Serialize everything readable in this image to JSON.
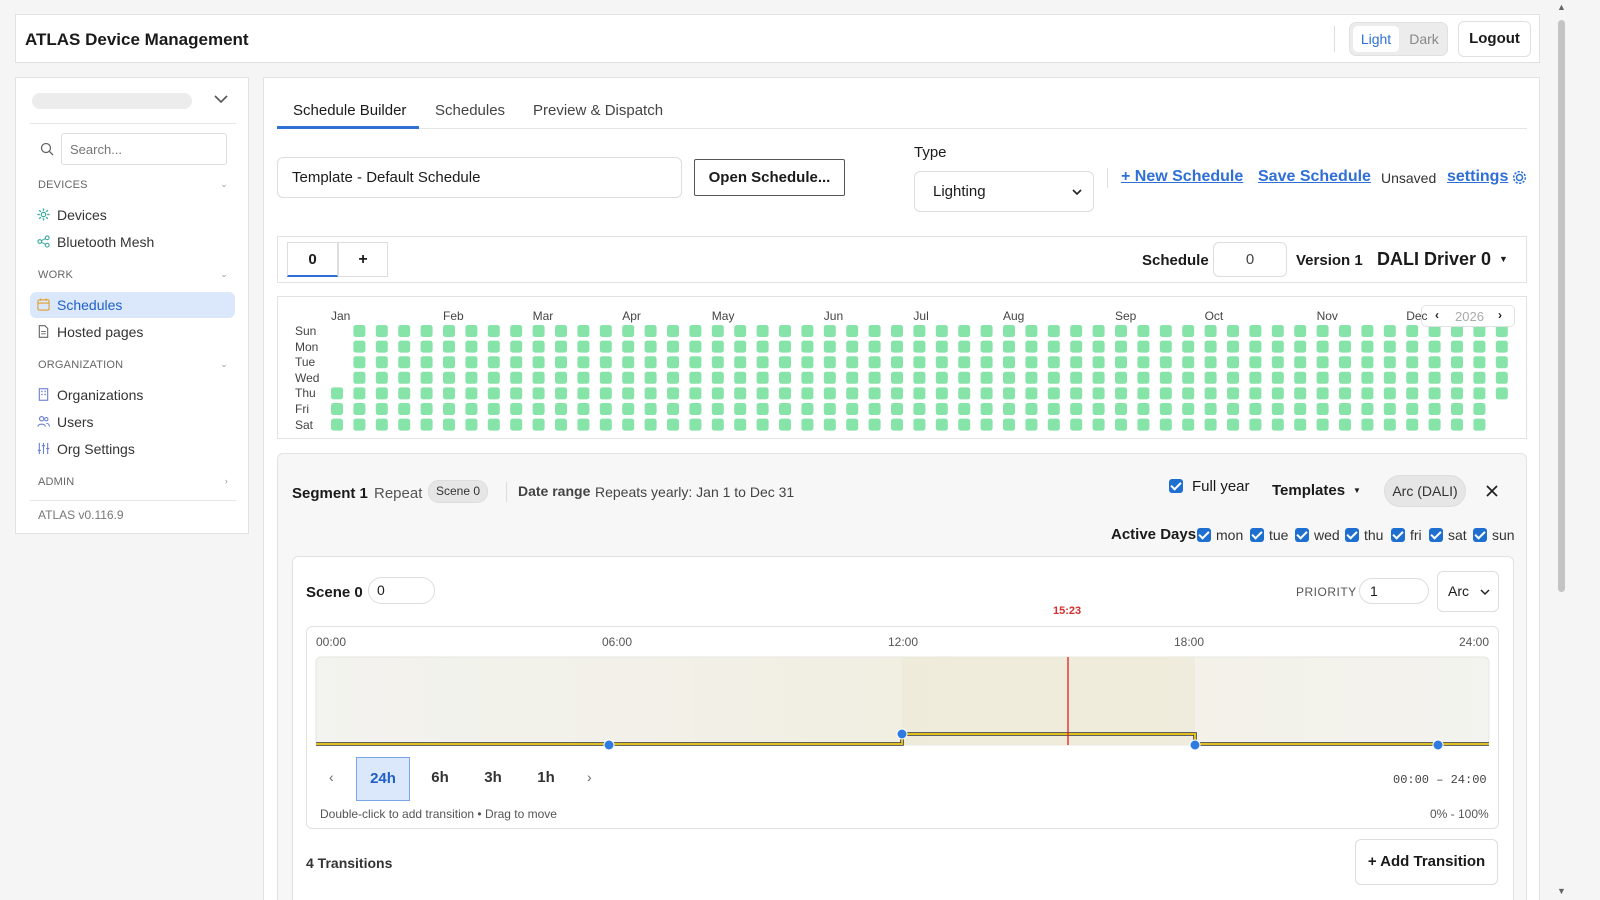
{
  "header": {
    "title": "ATLAS Device Management",
    "theme_light": "Light",
    "theme_dark": "Dark",
    "logout": "Logout"
  },
  "sidebar": {
    "search_placeholder": "Search...",
    "sections": [
      {
        "label": "DEVICES",
        "items": [
          {
            "label": "Devices",
            "icon": "gear-icon"
          },
          {
            "label": "Bluetooth Mesh",
            "icon": "share-icon"
          }
        ]
      },
      {
        "label": "WORK",
        "items": [
          {
            "label": "Schedules",
            "icon": "calendar-icon",
            "active": true
          },
          {
            "label": "Hosted pages",
            "icon": "file-icon"
          }
        ]
      },
      {
        "label": "ORGANIZATION",
        "items": [
          {
            "label": "Organizations",
            "icon": "building-icon"
          },
          {
            "label": "Users",
            "icon": "users-icon"
          },
          {
            "label": "Org Settings",
            "icon": "sliders-icon"
          }
        ]
      },
      {
        "label": "ADMIN",
        "items": []
      }
    ],
    "version": "ATLAS v0.116.9"
  },
  "tabs": [
    {
      "label": "Schedule Builder",
      "active": true
    },
    {
      "label": "Schedules"
    },
    {
      "label": "Preview & Dispatch"
    }
  ],
  "toolbar": {
    "template_name": "Template - Default Schedule",
    "open_schedule": "Open Schedule...",
    "type_label": "Type",
    "type_value": "Lighting",
    "new_schedule": "+ New Schedule",
    "save_schedule": "Save Schedule",
    "unsaved": "Unsaved",
    "settings": "settings"
  },
  "schedule_bar": {
    "segment_tab": "0",
    "add_tab": "+",
    "schedule_label": "Schedule",
    "schedule_value": "0",
    "version": "Version 1",
    "driver": "DALI Driver 0"
  },
  "calendar": {
    "year": "2026",
    "months": [
      "Jan",
      "Feb",
      "Mar",
      "Apr",
      "May",
      "Jun",
      "Jul",
      "Aug",
      "Sep",
      "Oct",
      "Nov",
      "Dec"
    ],
    "days": [
      "Sun",
      "Mon",
      "Tue",
      "Wed",
      "Thu",
      "Fri",
      "Sat"
    ],
    "active_color": "#86e4a8"
  },
  "segment": {
    "title": "Segment 1",
    "repeat": "Repeat",
    "scene_badge": "Scene 0",
    "date_range_label": "Date range",
    "date_range_value": "Repeats yearly: Jan 1 to Dec 31",
    "full_year_label": "Full year",
    "full_year_checked": true,
    "templates_label": "Templates",
    "arc_pill": "Arc (DALI)",
    "active_days_label": "Active Days",
    "active_days": [
      {
        "label": "mon",
        "checked": true
      },
      {
        "label": "tue",
        "checked": true
      },
      {
        "label": "wed",
        "checked": true
      },
      {
        "label": "thu",
        "checked": true
      },
      {
        "label": "fri",
        "checked": true
      },
      {
        "label": "sat",
        "checked": true
      },
      {
        "label": "sun",
        "checked": true
      }
    ]
  },
  "scene": {
    "title": "Scene 0",
    "value": "0",
    "priority_label": "PRIORITY",
    "priority_value": "1",
    "mode": "Arc",
    "now_label": "15:23",
    "ticks": [
      "00:00",
      "06:00",
      "12:00",
      "18:00",
      "24:00"
    ],
    "zoom_options": [
      "24h",
      "6h",
      "3h",
      "1h"
    ],
    "zoom_active": "24h",
    "range": "00:00 – 24:00",
    "hint": "Double-click to add transition • Drag to move",
    "percent_range": "0% - 100%",
    "transitions_label": "4 Transitions",
    "add_transition": "+ Add Transition",
    "line_color": "#e0c020",
    "point_color": "#2f7be0",
    "now_color": "#e02020"
  }
}
